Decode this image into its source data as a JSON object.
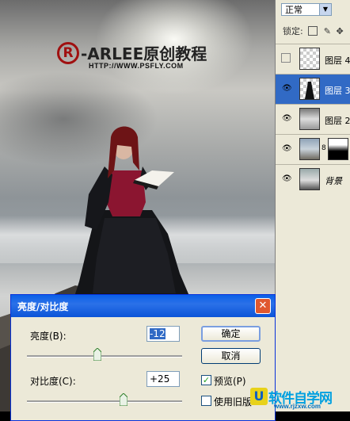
{
  "watermark": {
    "brand": "-ARLEE原创教程",
    "url": "HTTP://WWW.PSFLY.COM"
  },
  "layers_panel": {
    "blend_mode": "正常",
    "lock_label": "锁定:",
    "layers": [
      {
        "name": "图层 4",
        "visible": false,
        "selected": false,
        "thumb": "checker"
      },
      {
        "name": "图层 3",
        "visible": true,
        "selected": true,
        "thumb": "figure"
      },
      {
        "name": "图层 2",
        "visible": true,
        "selected": false,
        "thumb": "sky"
      },
      {
        "name": "",
        "visible": true,
        "selected": false,
        "thumb": "sea-mask"
      },
      {
        "name": "背景",
        "visible": true,
        "selected": false,
        "thumb": "background"
      }
    ]
  },
  "dialog": {
    "title": "亮度/对比度",
    "brightness_label": "亮度(B):",
    "brightness_value": "-12",
    "brightness_level": -12,
    "contrast_label": "对比度(C):",
    "contrast_value": "+25",
    "contrast_level": 25,
    "ok_label": "确定",
    "cancel_label": "取消",
    "preview_label": "预览(P)",
    "preview_checked": true,
    "legacy_label": "使用旧版",
    "legacy_checked": false
  },
  "site_logo": {
    "badge": "U",
    "name": "软件自学网",
    "url": "www.rjzxw.com"
  },
  "colors": {
    "titlebar": "#0a5fe8",
    "selected_layer": "#316ac5",
    "watermark_red": "#a01010"
  }
}
